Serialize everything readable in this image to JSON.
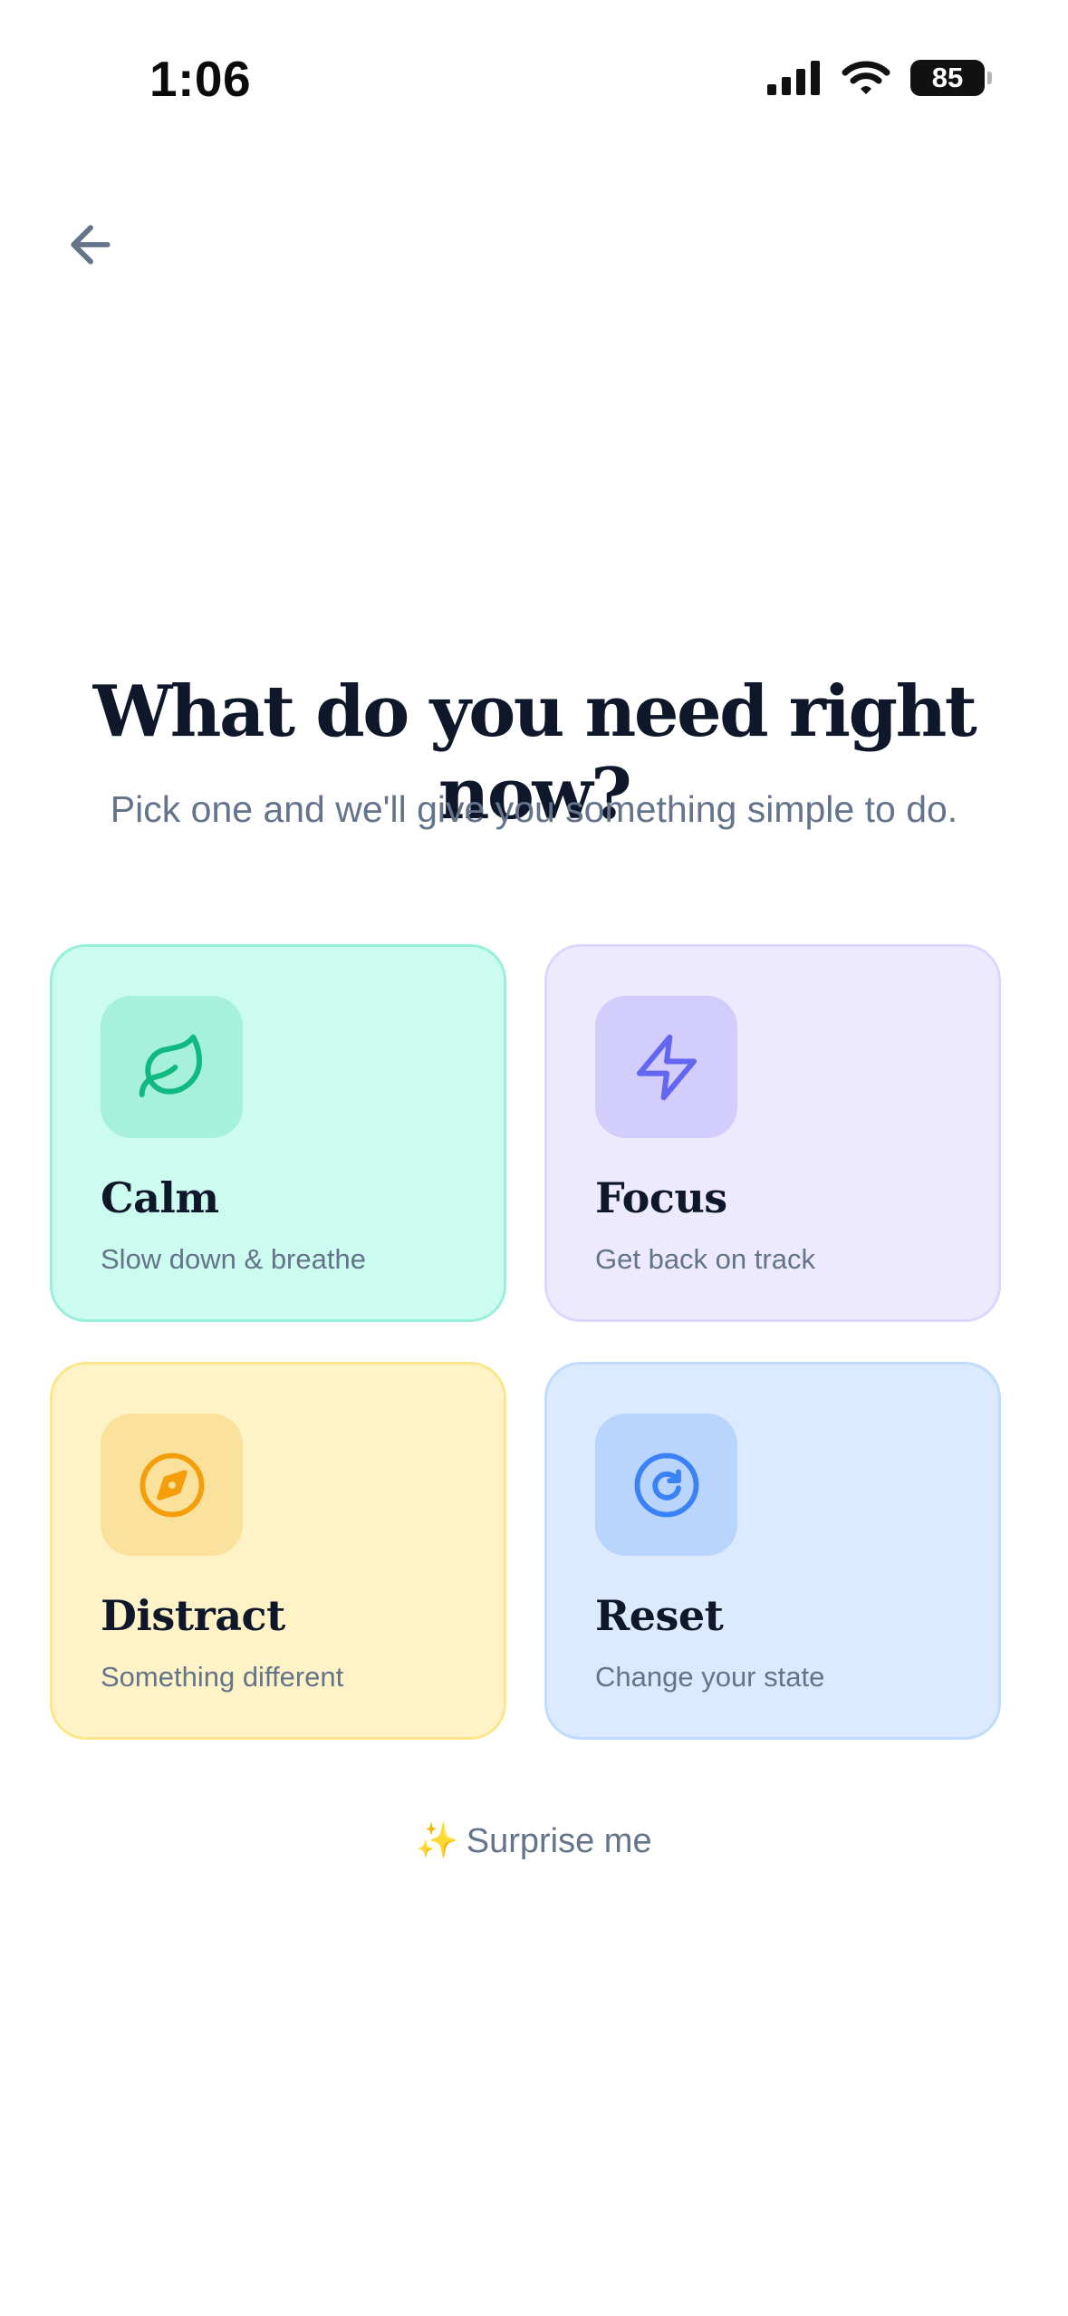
{
  "status_bar": {
    "time": "1:06",
    "battery": "85"
  },
  "header": {
    "title": "What do you need right now?",
    "subtitle": "Pick one and we'll give you something simple to do."
  },
  "cards": [
    {
      "title": "Calm",
      "description": "Slow down & breathe",
      "icon": "leaf-icon",
      "color": "#10b981"
    },
    {
      "title": "Focus",
      "description": "Get back on track",
      "icon": "lightning-icon",
      "color": "#6366f1"
    },
    {
      "title": "Distract",
      "description": "Something different",
      "icon": "compass-icon",
      "color": "#f59e0b"
    },
    {
      "title": "Reset",
      "description": "Change your state",
      "icon": "refresh-icon",
      "color": "#3b82f6"
    }
  ],
  "surprise": {
    "sparkle": "✨",
    "label": "Surprise me"
  }
}
